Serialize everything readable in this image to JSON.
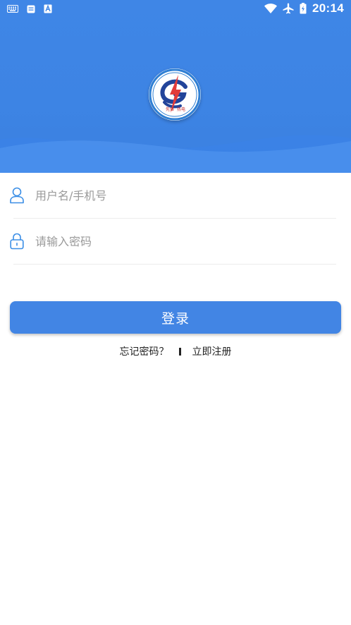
{
  "status_bar": {
    "time": "20:14",
    "left_icons": [
      "keyboard-icon",
      "message-icon",
      "text-a-icon"
    ],
    "right_icons": [
      "wifi-icon",
      "airplane-mode-icon",
      "battery-icon"
    ]
  },
  "header": {
    "logo": {
      "name": "company-logo",
      "colors": {
        "ring": "#2f7fd3",
        "lightning": "#e23b3b",
        "text": "#c62828"
      },
      "seal_text": [
        "先锋",
        "热电"
      ]
    },
    "background_color": "#3f86e6"
  },
  "form": {
    "username": {
      "placeholder": "用户名/手机号",
      "value": ""
    },
    "password": {
      "placeholder": "请输入密码",
      "value": ""
    },
    "login_label": "登录"
  },
  "links": {
    "forgot_password": "忘记密码？",
    "register": "立即注册"
  },
  "colors": {
    "accent": "#4285e4",
    "icon_blue": "#3a8ee6"
  }
}
